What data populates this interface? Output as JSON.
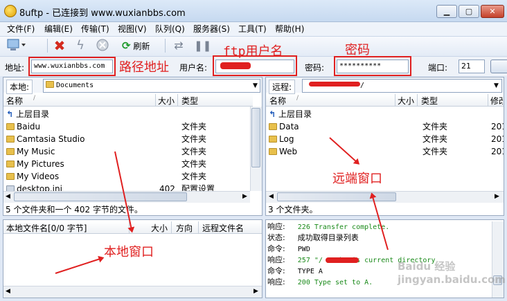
{
  "window": {
    "title": "8uftp - 已连接到 www.wuxianbbs.com"
  },
  "menu": [
    "文件(F)",
    "编辑(E)",
    "传输(T)",
    "视图(V)",
    "队列(Q)",
    "服务器(S)",
    "工具(T)",
    "帮助(H)"
  ],
  "toolbar": {
    "refresh_label": "刷新"
  },
  "connection": {
    "address_label": "地址:",
    "address_value": "www.wuxianbbs.com",
    "user_label": "用户名:",
    "user_value": "",
    "password_label": "密码:",
    "password_value": "**********",
    "port_label": "端口:",
    "port_value": "21"
  },
  "annotations": {
    "path": "路径地址",
    "ftp_user": "ftp用户名",
    "password": "密码",
    "remote_window": "远端窗口",
    "local_window": "本地窗口"
  },
  "local": {
    "path_label": "本地:",
    "path_value": "Documents",
    "columns": {
      "name": "名称",
      "size": "大小",
      "type": "类型"
    },
    "up_label": "上层目录",
    "rows": [
      {
        "name": "Baidu",
        "size": "",
        "type": "文件夹"
      },
      {
        "name": "Camtasia Studio",
        "size": "",
        "type": "文件夹"
      },
      {
        "name": "My Music",
        "size": "",
        "type": "文件夹"
      },
      {
        "name": "My Pictures",
        "size": "",
        "type": "文件夹"
      },
      {
        "name": "My Videos",
        "size": "",
        "type": "文件夹"
      },
      {
        "name": "desktop.ini",
        "size": "402",
        "type": "配置设置"
      }
    ],
    "status": "5 个文件夹和一个 402 字节的文件。"
  },
  "remote": {
    "path_label": "远程:",
    "path_value": "/",
    "columns": {
      "name": "名称",
      "size": "大小",
      "type": "类型",
      "modified": "修改"
    },
    "up_label": "上层目录",
    "rows": [
      {
        "name": "Data",
        "type": "文件夹",
        "modified": "201"
      },
      {
        "name": "Log",
        "type": "文件夹",
        "modified": "201"
      },
      {
        "name": "Web",
        "type": "文件夹",
        "modified": "201"
      }
    ],
    "status": "3 个文件夹。"
  },
  "queue": {
    "columns": {
      "local_name": "本地文件名[0/0 字节]",
      "size": "大小",
      "direction": "方向",
      "remote_name": "远程文件名"
    }
  },
  "log": [
    {
      "key": "响应:",
      "text": "226 Transfer complete.",
      "green": true
    },
    {
      "key": "状态:",
      "text": "成功取得目录列表",
      "green": false
    },
    {
      "key": "命令:",
      "text": "PWD",
      "green": false
    },
    {
      "key": "响应:",
      "text": "257 \"/     /Web\" is current directory",
      "green": true
    },
    {
      "key": "命令:",
      "text": "TYPE A",
      "green": false
    },
    {
      "key": "响应:",
      "text": "200 Type set to A.",
      "green": true
    }
  ],
  "colors": {
    "annotation": "#e02020",
    "log_green": "#1a8a1a"
  },
  "watermark": "Baidu 经验 jingyan.baidu.com"
}
